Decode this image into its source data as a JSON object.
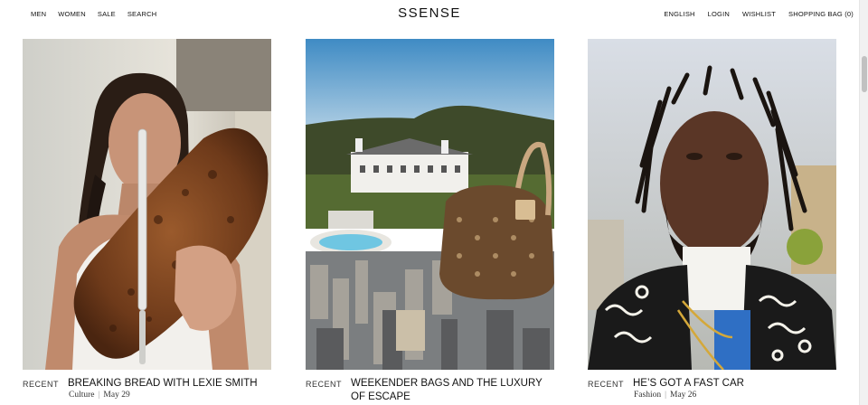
{
  "nav": {
    "left": [
      "MEN",
      "WOMEN",
      "SALE",
      "SEARCH"
    ],
    "logo": "SSENSE",
    "right": [
      "ENGLISH",
      "LOGIN",
      "WISHLIST",
      "SHOPPING BAG (0)"
    ]
  },
  "articles": [
    {
      "tag": "RECENT",
      "title": "BREAKING BREAD WITH LEXIE SMITH",
      "category": "Culture",
      "date": "May 29"
    },
    {
      "tag": "RECENT",
      "title": "WEEKENDER BAGS AND THE LUXURY OF ESCAPE",
      "category": "",
      "date": ""
    },
    {
      "tag": "RECENT",
      "title": "HE’S GOT A FAST CAR",
      "category": "Fashion",
      "date": "May 26"
    }
  ]
}
